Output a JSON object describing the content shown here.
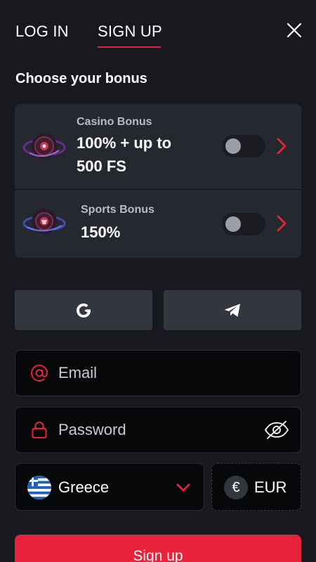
{
  "header": {
    "login_tab": "LOG IN",
    "signup_tab": "SIGN UP",
    "active_tab": "SIGN UP"
  },
  "bonus": {
    "title": "Choose your bonus",
    "items": [
      {
        "label": "Casino Bonus",
        "value": "100% + up to 500 FS",
        "enabled": false
      },
      {
        "label": "Sports Bonus",
        "value": "150%",
        "enabled": false
      }
    ]
  },
  "social": {
    "google_icon": "google-icon",
    "telegram_icon": "telegram-icon"
  },
  "form": {
    "email_placeholder": "Email",
    "password_placeholder": "Password",
    "country": "Greece",
    "currency_symbol": "€",
    "currency": "EUR",
    "submit_label": "Sign up"
  },
  "colors": {
    "accent": "#e8223a",
    "background": "#17191f",
    "card": "#262830",
    "button": "#33353f"
  }
}
